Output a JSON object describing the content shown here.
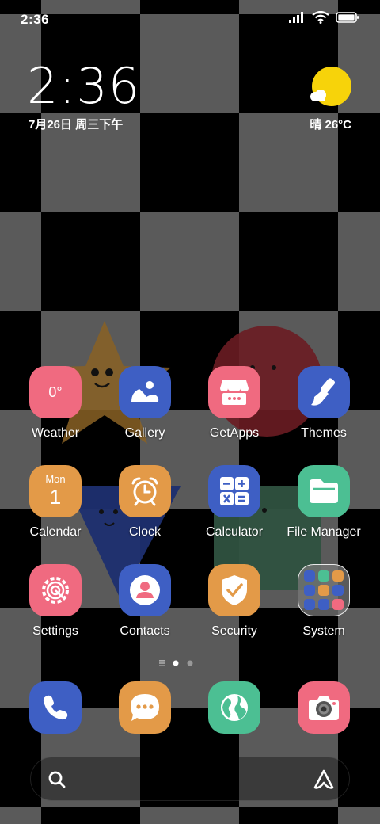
{
  "status_bar": {
    "time": "2:36"
  },
  "clock_widget": {
    "time": "2:36",
    "date": "7月26日 周三下午"
  },
  "weather_widget": {
    "text": "晴 26°C"
  },
  "apps": [
    {
      "label": "Weather",
      "color": "#f06a80",
      "icon_text": "0°",
      "icon": "weather-icon"
    },
    {
      "label": "Gallery",
      "color": "#3e5fc4",
      "icon": "gallery-icon"
    },
    {
      "label": "GetApps",
      "color": "#f06a80",
      "icon": "store-icon"
    },
    {
      "label": "Themes",
      "color": "#3e5fc4",
      "icon": "brush-icon"
    },
    {
      "label": "Calendar",
      "color": "#e39a48",
      "icon_text_top": "Mon",
      "icon_text": "1",
      "icon": "calendar-icon"
    },
    {
      "label": "Clock",
      "color": "#e39a48",
      "icon": "alarm-clock-icon"
    },
    {
      "label": "Calculator",
      "color": "#3e5fc4",
      "icon": "calculator-icon"
    },
    {
      "label": "File Manager",
      "color": "#4cbf93",
      "icon": "folder-icon"
    },
    {
      "label": "Settings",
      "color": "#f06a80",
      "icon": "gear-icon"
    },
    {
      "label": "Contacts",
      "color": "#3e5fc4",
      "icon": "person-icon"
    },
    {
      "label": "Security",
      "color": "#e39a48",
      "icon": "shield-icon"
    },
    {
      "label": "System",
      "icon": "folder-preview-icon"
    }
  ],
  "pager": {
    "pages": 2,
    "current": 1
  },
  "dock": [
    {
      "name": "phone",
      "color": "#3e5fc4",
      "icon": "phone-icon"
    },
    {
      "name": "messages",
      "color": "#e39a48",
      "icon": "chat-bubble-icon"
    },
    {
      "name": "browser",
      "color": "#4cbf93",
      "icon": "globe-icon"
    },
    {
      "name": "camera",
      "color": "#f06a80",
      "icon": "camera-icon"
    }
  ],
  "search": {
    "left_icon": "search-icon",
    "right_icon": "assistant-icon"
  }
}
